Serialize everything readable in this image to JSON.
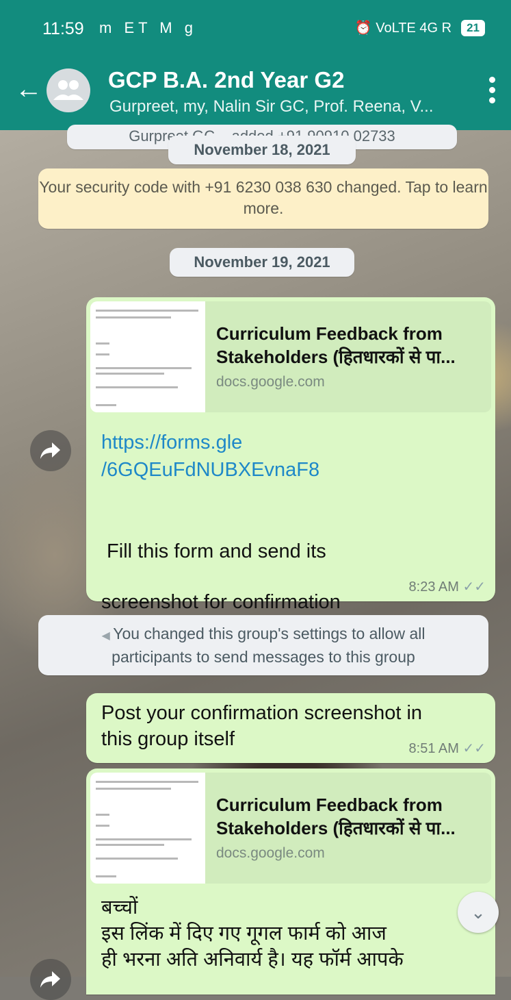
{
  "status_bar": {
    "time": "11:59",
    "left_icons": "m ET M g",
    "right_icons": "⏰ VoLTE 4G R",
    "battery": "21"
  },
  "header": {
    "title": "GCP B.A. 2nd Year G2",
    "subtitle": "Gurpreet, my, Nalin Sir GC, Prof. Reena, V..."
  },
  "chat": {
    "partial_top_notice": "Gurpreet GC... added +91 90910 02733",
    "date_chip_1": "November 18, 2021",
    "security_notice": "Your security code with +91 6230 038 630 changed. Tap to learn more.",
    "date_chip_2": "November 19, 2021",
    "message_1": {
      "preview_title_line1": "Curriculum Feedback from",
      "preview_title_line2": "Stakeholders (हितधारकों से पा...",
      "preview_domain": "docs.google.com",
      "link_line1": "https://forms.gle",
      "link_line2": "/6GQEuFdNUBXEvnaF8",
      "text_line1": " Fill this form and send its",
      "text_line2": "screenshot for confirmation",
      "time": "8:23 AM"
    },
    "settings_notice_line1": "You changed this group's settings to allow all",
    "settings_notice_line2": "participants to send messages to this group",
    "message_2": {
      "text_line1": "Post your confirmation screenshot in",
      "text_line2": "this group itself",
      "time": "8:51 AM"
    },
    "message_3": {
      "preview_title_line1": "Curriculum Feedback from",
      "preview_title_line2": "Stakeholders (हितधारकों से पा...",
      "preview_domain": "docs.google.com",
      "text_line1": "बच्चों",
      "text_line2": "इस लिंक में दिए गए गूगल फार्म को आज",
      "text_line3": "ही भरना अति अनिवार्य है। यह फॉर्म आपके"
    }
  },
  "colors": {
    "header": "#128c7e",
    "outgoing_bubble": "#dcf8c6",
    "link": "#1e88c8"
  }
}
